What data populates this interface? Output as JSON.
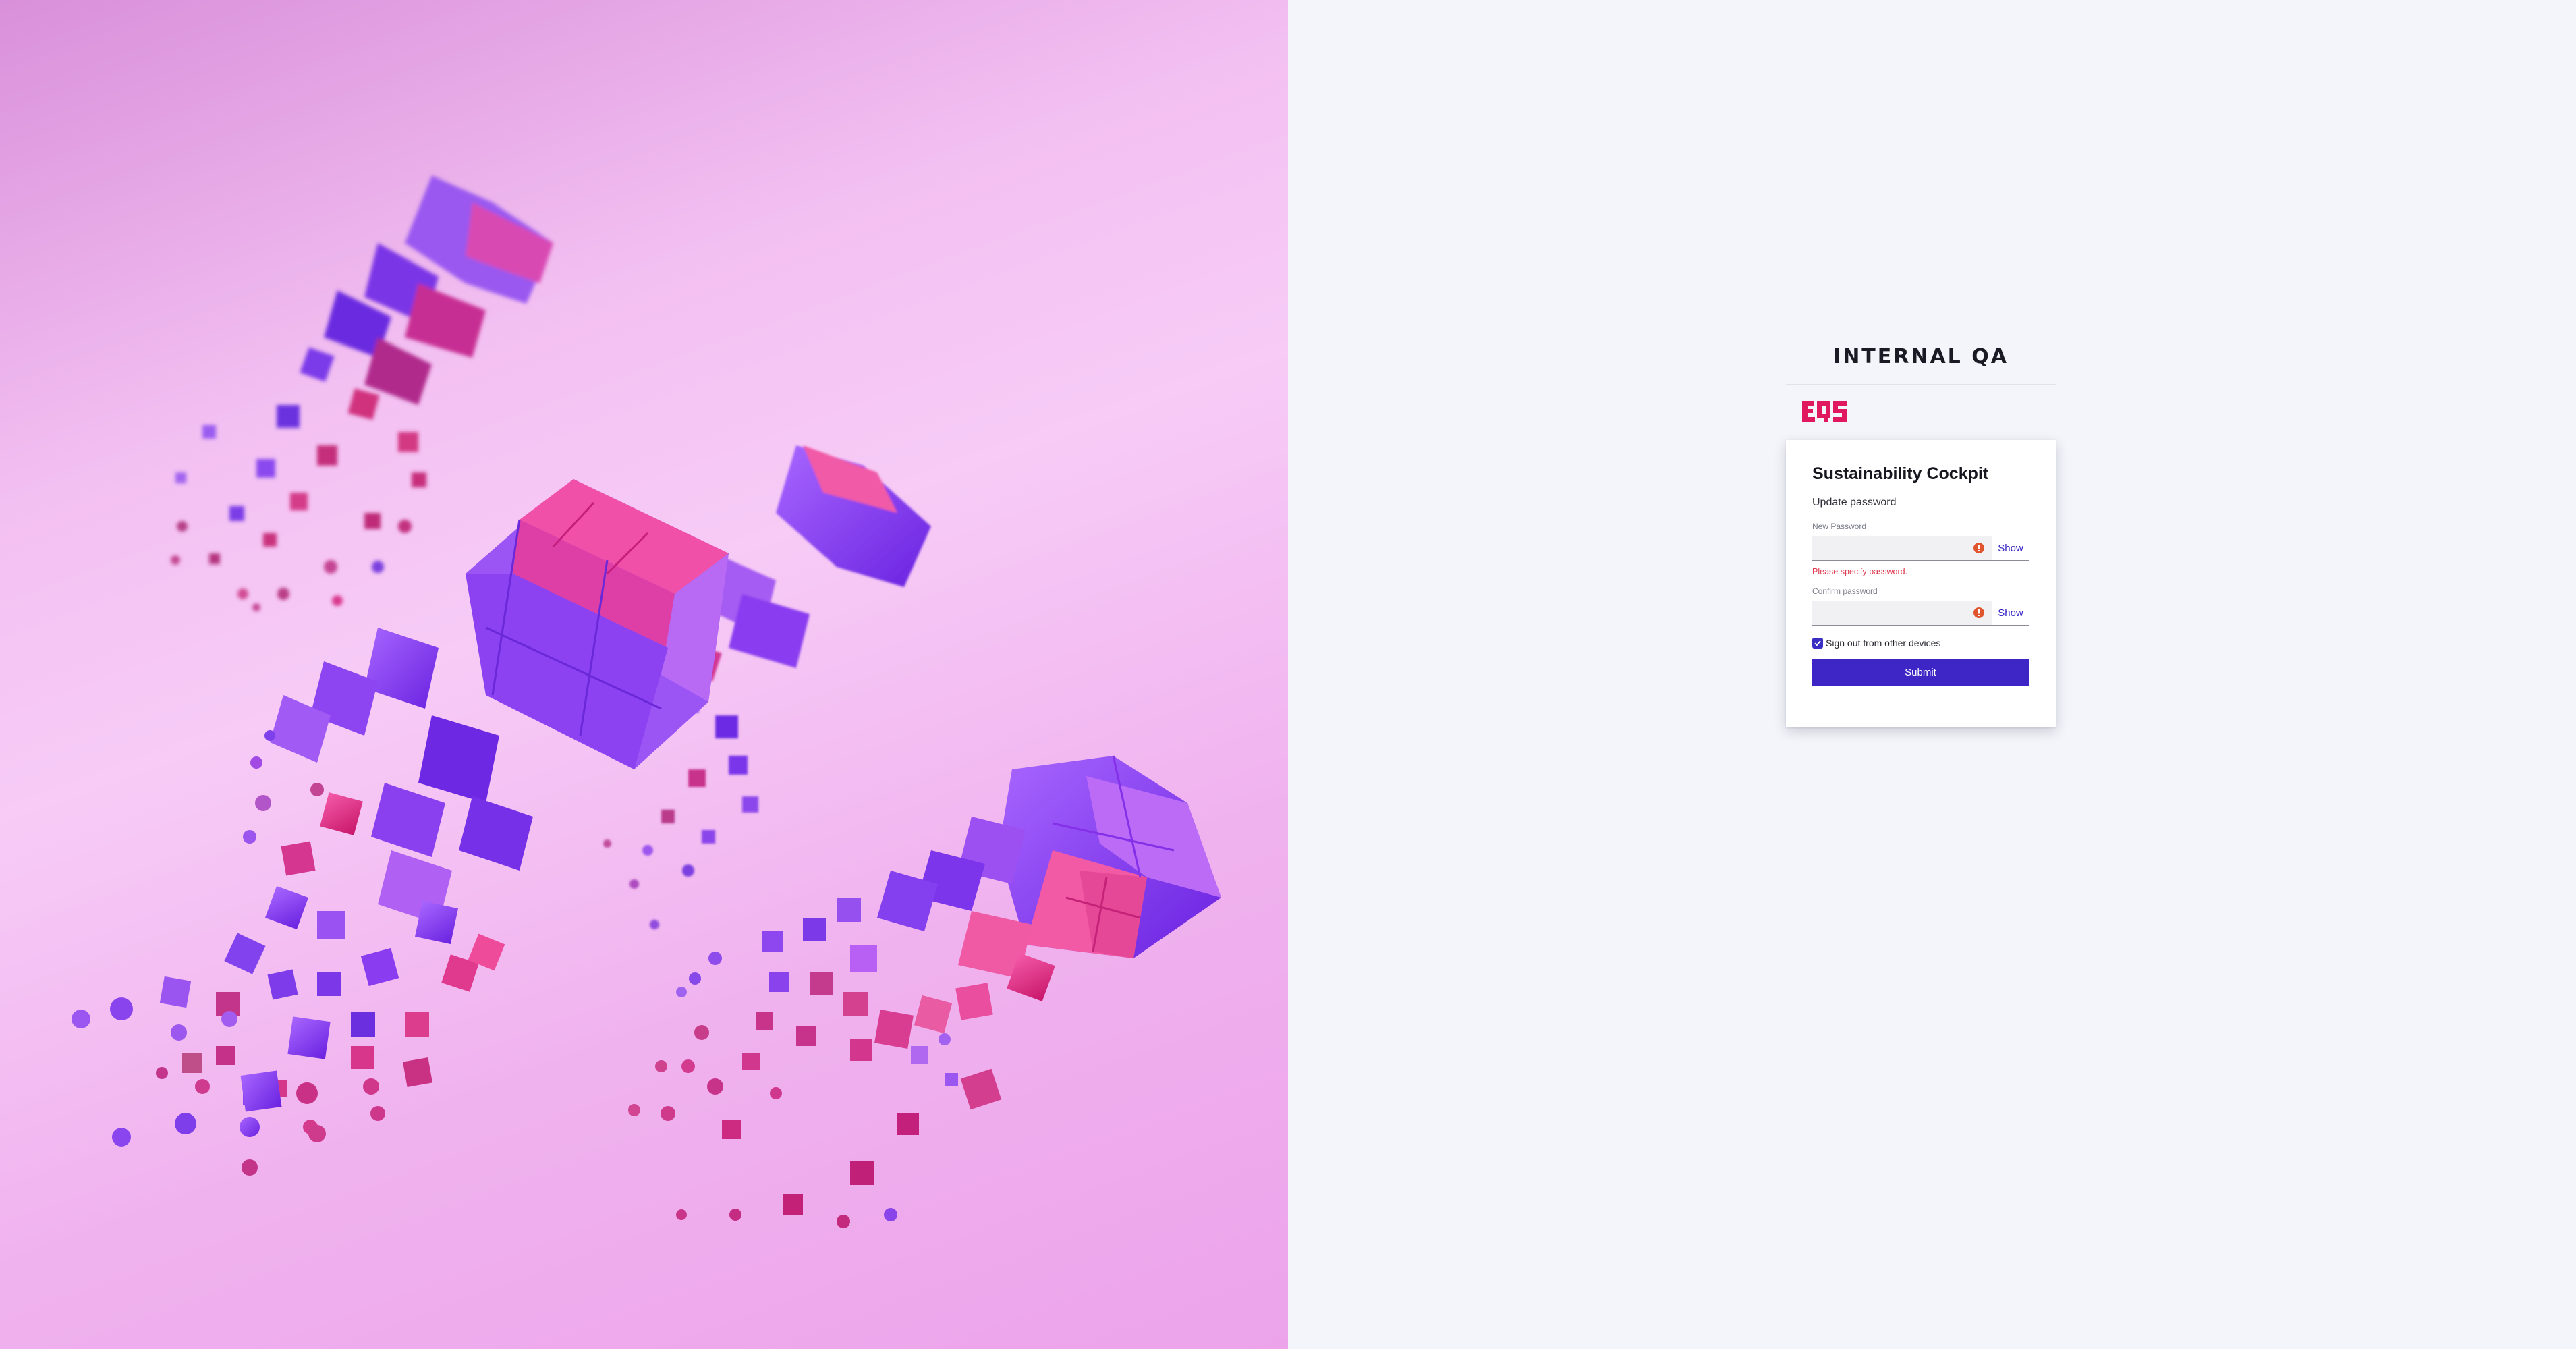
{
  "header": {
    "environment_title": "INTERNAL QA",
    "logo_text": "EQS"
  },
  "card": {
    "title": "Sustainability Cockpit",
    "subtitle": "Update password",
    "new_password": {
      "label": "New Password",
      "value": "",
      "show_label": "Show",
      "error": "Please specify password."
    },
    "confirm_password": {
      "label": "Confirm password",
      "value": "",
      "show_label": "Show"
    },
    "sign_out_checkbox": {
      "label": "Sign out from other devices",
      "checked": true
    },
    "submit_label": "Submit"
  },
  "colors": {
    "brand_accent": "#3d26c5",
    "logo": "#e0185e",
    "error": "#e0384e",
    "panel_bg": "#f4f5fa",
    "hero_pink": "#f3c0f2",
    "hero_purple": "#8a3cf0",
    "hero_magenta": "#e02680"
  },
  "icons": {
    "field_status": "alert-circle-icon",
    "checkbox": "check-icon"
  }
}
